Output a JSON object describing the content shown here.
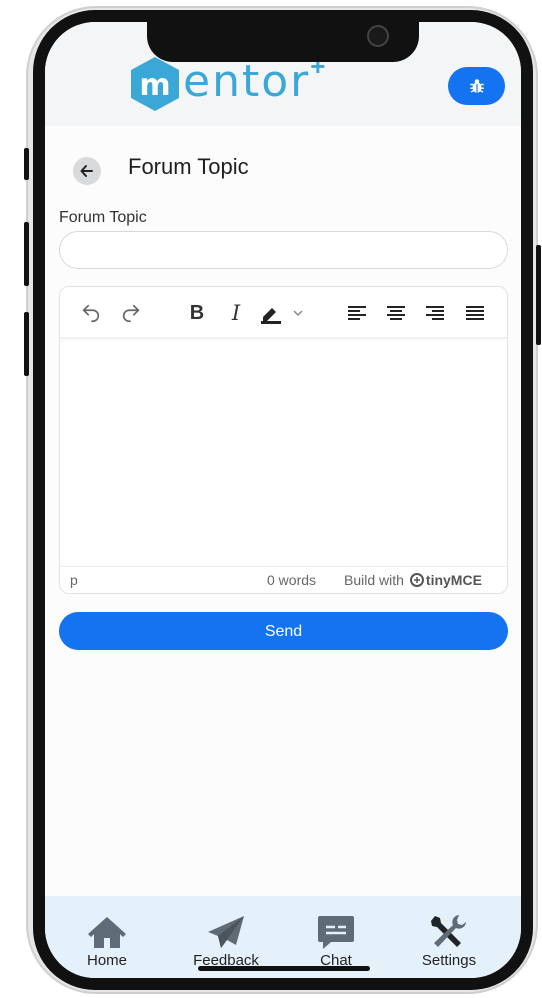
{
  "app": {
    "logo_text": "entor",
    "logo_plus": "+",
    "logo_mark": "m"
  },
  "page": {
    "title": "Forum Topic"
  },
  "form": {
    "topic_label": "Forum Topic",
    "topic_value": "",
    "topic_placeholder": ""
  },
  "editor": {
    "toolbar": [
      {
        "name": "undo-icon"
      },
      {
        "name": "redo-icon"
      },
      {
        "name": "bold-icon",
        "glyph": "B"
      },
      {
        "name": "italic-icon",
        "glyph": "I"
      },
      {
        "name": "highlight-icon"
      },
      {
        "name": "align-left-icon"
      },
      {
        "name": "align-center-icon"
      },
      {
        "name": "align-right-icon"
      },
      {
        "name": "justify-icon"
      }
    ],
    "status_path": "p",
    "word_count": "0 words",
    "branding_prefix": "Build with",
    "branding_name": "tinyMCE"
  },
  "actions": {
    "send_label": "Send"
  },
  "nav": {
    "items": [
      {
        "label": "Home",
        "icon": "home-icon"
      },
      {
        "label": "Feedback",
        "icon": "paper-plane-icon"
      },
      {
        "label": "Chat",
        "icon": "chat-icon"
      },
      {
        "label": "Settings",
        "icon": "tools-icon"
      }
    ]
  },
  "colors": {
    "primary": "#1473f0",
    "logo": "#3aa7d6",
    "nav_bg": "#e4f1fb",
    "nav_icon": "#5f6b75"
  }
}
